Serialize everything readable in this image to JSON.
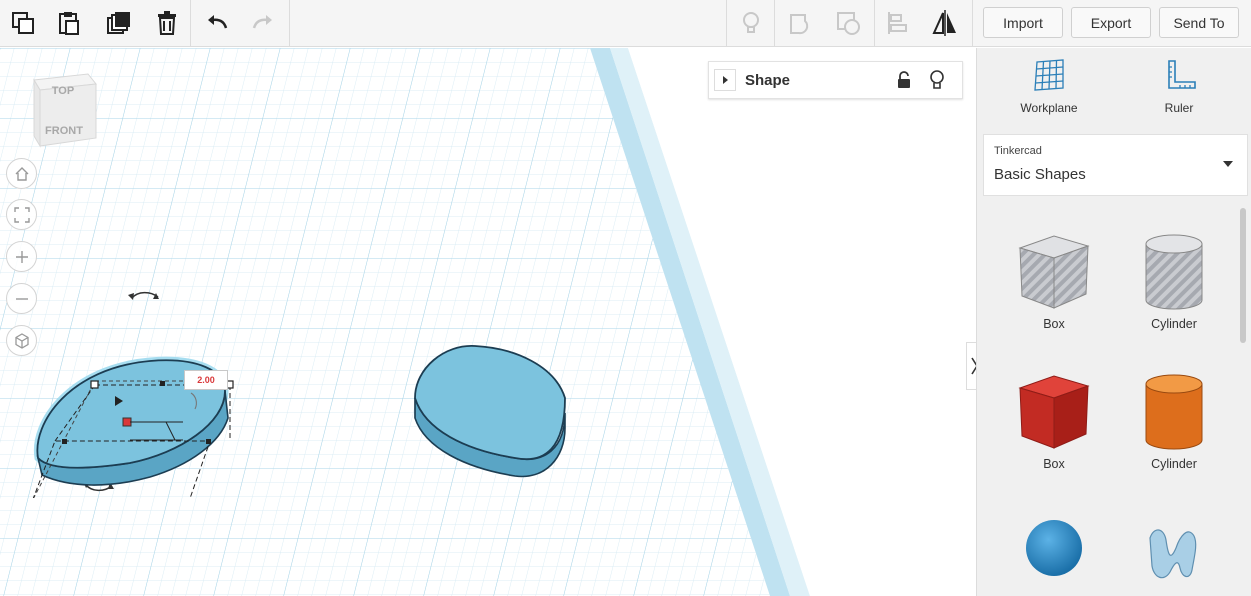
{
  "toolbar": {
    "import_label": "Import",
    "export_label": "Export",
    "send_to_label": "Send To",
    "icons": [
      "copy-icon",
      "paste-icon",
      "duplicate-icon",
      "delete-icon",
      "undo-icon",
      "redo-icon",
      "lightbulb-icon",
      "group-icon",
      "ungroup-icon",
      "align-icon",
      "mirror-icon"
    ]
  },
  "view_cube": {
    "top_label": "TOP",
    "front_label": "FRONT"
  },
  "nav_buttons": [
    "home-view",
    "fit-all",
    "zoom-in",
    "zoom-out",
    "perspective"
  ],
  "shape_panel": {
    "title": "Shape"
  },
  "dimension_label": "2.00",
  "sidebar": {
    "workplane_label": "Workplane",
    "ruler_label": "Ruler",
    "library": {
      "category": "Tinkercad",
      "name": "Basic Shapes"
    },
    "shapes": [
      {
        "label": "Box",
        "color": "#b9bcc4"
      },
      {
        "label": "Cylinder",
        "color": "#c0c3c9"
      },
      {
        "label": "Box",
        "color": "#cc2a22"
      },
      {
        "label": "Cylinder",
        "color": "#e07a24"
      },
      {
        "label": "",
        "color": "#2b8ccc"
      },
      {
        "label": "",
        "color": "#9ec6e0"
      }
    ]
  },
  "colors": {
    "shape_blue": "#7cc3de",
    "grid_line": "#cfe7f2",
    "accent_red": "#d9383a"
  }
}
